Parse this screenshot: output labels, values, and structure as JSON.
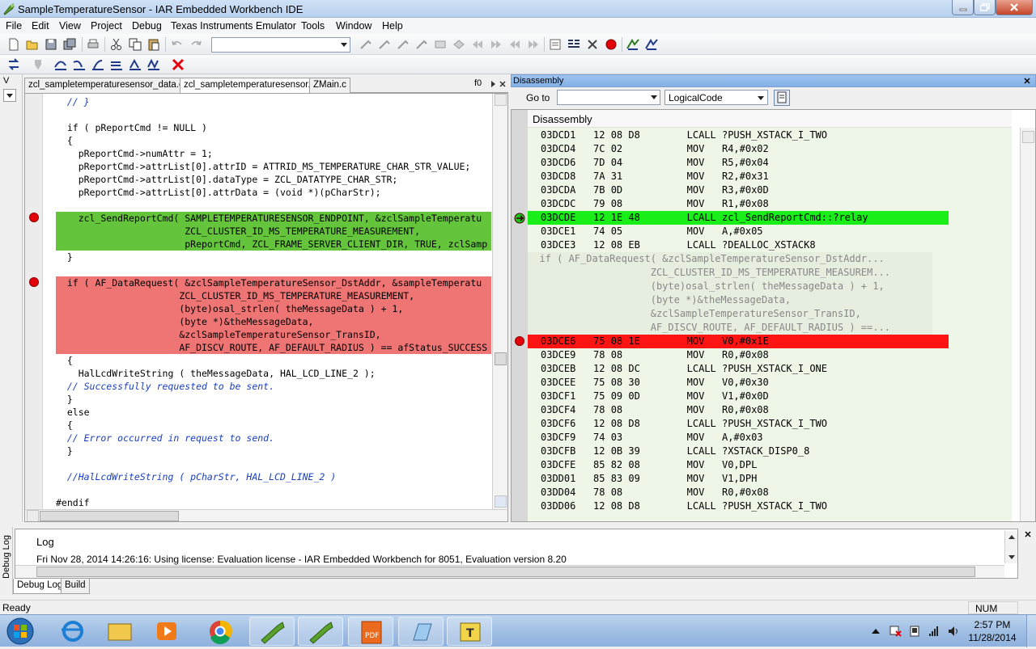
{
  "window": {
    "title": "SampleTemperatureSensor - IAR Embedded Workbench IDE"
  },
  "menu": [
    "File",
    "Edit",
    "View",
    "Project",
    "Debug",
    "Texas Instruments Emulator",
    "Tools",
    "Window",
    "Help"
  ],
  "editor": {
    "tabs": [
      {
        "label": "zcl_sampletemperaturesensor_data.c",
        "active": false
      },
      {
        "label": "zcl_sampletemperaturesensor.c",
        "active": true
      },
      {
        "label": "ZMain.c",
        "active": false
      }
    ],
    "func_combo": "f0",
    "lines": [
      {
        "text": "  // }",
        "style": "cmt"
      },
      {
        "text": "",
        "style": ""
      },
      {
        "text": "  if ( pReportCmd != NULL )",
        "style": ""
      },
      {
        "text": "  {",
        "style": ""
      },
      {
        "text": "    pReportCmd->numAttr = 1;",
        "style": ""
      },
      {
        "text": "    pReportCmd->attrList[0].attrID = ATTRID_MS_TEMPERATURE_CHAR_STR_VALUE;",
        "style": ""
      },
      {
        "text": "    pReportCmd->attrList[0].dataType = ZCL_DATATYPE_CHAR_STR;",
        "style": ""
      },
      {
        "text": "    pReportCmd->attrList[0].attrData = (void *)(pCharStr);",
        "style": ""
      },
      {
        "text": "",
        "style": ""
      },
      {
        "text": "    zcl_SendReportCmd( SAMPLETEMPERATURESENSOR_ENDPOINT, &zclSampleTemperatu",
        "style": "green"
      },
      {
        "text": "                       ZCL_CLUSTER_ID_MS_TEMPERATURE_MEASUREMENT,",
        "style": "green"
      },
      {
        "text": "                       pReportCmd, ZCL_FRAME_SERVER_CLIENT_DIR, TRUE, zclSamp",
        "style": "green"
      },
      {
        "text": "  }",
        "style": ""
      },
      {
        "text": "",
        "style": ""
      },
      {
        "text": "  if ( AF_DataRequest( &zclSampleTemperatureSensor_DstAddr, &sampleTemperatu",
        "style": "red"
      },
      {
        "text": "                      ZCL_CLUSTER_ID_MS_TEMPERATURE_MEASUREMENT,",
        "style": "red"
      },
      {
        "text": "                      (byte)osal_strlen( theMessageData ) + 1,",
        "style": "red"
      },
      {
        "text": "                      (byte *)&theMessageData,",
        "style": "red"
      },
      {
        "text": "                      &zclSampleTemperatureSensor_TransID,",
        "style": "red"
      },
      {
        "text": "                      AF_DISCV_ROUTE, AF_DEFAULT_RADIUS ) == afStatus_SUCCESS )",
        "style": "red"
      },
      {
        "text": "  {",
        "style": ""
      },
      {
        "text": "    HalLcdWriteString ( theMessageData, HAL_LCD_LINE_2 );",
        "style": ""
      },
      {
        "text": "  // Successfully requested to be sent.",
        "style": "cmt"
      },
      {
        "text": "  }",
        "style": ""
      },
      {
        "text": "  else",
        "style": ""
      },
      {
        "text": "  {",
        "style": ""
      },
      {
        "text": "  // Error occurred in request to send.",
        "style": "cmt"
      },
      {
        "text": "  }",
        "style": ""
      },
      {
        "text": "",
        "style": ""
      },
      {
        "text": "  //HalLcdWriteString ( pCharStr, HAL_LCD_LINE_2 )",
        "style": "cmt"
      },
      {
        "text": "",
        "style": ""
      },
      {
        "text": "#endif",
        "style": ""
      }
    ]
  },
  "disassembly": {
    "title": "Disassembly",
    "goto_label": "Go to",
    "goto_value": "",
    "mode": "LogicalCode",
    "header": "Disassembly",
    "rows": [
      {
        "text": "03DCD1   12 08 D8        LCALL ?PUSH_XSTACK_I_TWO",
        "kind": "asm"
      },
      {
        "text": "03DCD4   7C 02           MOV   R4,#0x02",
        "kind": "asm"
      },
      {
        "text": "03DCD6   7D 04           MOV   R5,#0x04",
        "kind": "asm"
      },
      {
        "text": "03DCD8   7A 31           MOV   R2,#0x31",
        "kind": "asm"
      },
      {
        "text": "03DCDA   7B 0D           MOV   R3,#0x0D",
        "kind": "asm"
      },
      {
        "text": "03DCDC   79 08           MOV   R1,#0x08",
        "kind": "asm"
      },
      {
        "text": "03DCDE   12 1E 48        LCALL zcl_SendReportCmd::?relay",
        "kind": "green"
      },
      {
        "text": "03DCE1   74 05           MOV   A,#0x05",
        "kind": "asm"
      },
      {
        "text": "03DCE3   12 08 EB        LCALL ?DEALLOC_XSTACK8",
        "kind": "asm"
      },
      {
        "text": "  if ( AF_DataRequest( &zclSampleTemperatureSensor_DstAddr...",
        "kind": "src"
      },
      {
        "text": "                     ZCL_CLUSTER_ID_MS_TEMPERATURE_MEASUREM...",
        "kind": "src"
      },
      {
        "text": "                     (byte)osal_strlen( theMessageData ) + 1,",
        "kind": "src"
      },
      {
        "text": "                     (byte *)&theMessageData,",
        "kind": "src"
      },
      {
        "text": "                     &zclSampleTemperatureSensor_TransID,",
        "kind": "src"
      },
      {
        "text": "                     AF_DISCV_ROUTE, AF_DEFAULT_RADIUS ) ==...",
        "kind": "src"
      },
      {
        "text": "03DCE6   75 08 1E        MOV   V0,#0x1E",
        "kind": "red"
      },
      {
        "text": "03DCE9   78 08           MOV   R0,#0x08",
        "kind": "asm"
      },
      {
        "text": "03DCEB   12 08 DC        LCALL ?PUSH_XSTACK_I_ONE",
        "kind": "asm"
      },
      {
        "text": "03DCEE   75 08 30        MOV   V0,#0x30",
        "kind": "asm"
      },
      {
        "text": "03DCF1   75 09 0D        MOV   V1,#0x0D",
        "kind": "asm"
      },
      {
        "text": "03DCF4   78 08           MOV   R0,#0x08",
        "kind": "asm"
      },
      {
        "text": "03DCF6   12 08 D8        LCALL ?PUSH_XSTACK_I_TWO",
        "kind": "asm"
      },
      {
        "text": "03DCF9   74 03           MOV   A,#0x03",
        "kind": "asm"
      },
      {
        "text": "03DCFB   12 0B 39        LCALL ?XSTACK_DISP0_8",
        "kind": "asm"
      },
      {
        "text": "03DCFE   85 82 08        MOV   V0,DPL",
        "kind": "asm"
      },
      {
        "text": "03DD01   85 83 09        MOV   V1,DPH",
        "kind": "asm"
      },
      {
        "text": "03DD04   78 08           MOV   R0,#0x08",
        "kind": "asm"
      },
      {
        "text": "03DD06   12 08 D8        LCALL ?PUSH_XSTACK_I_TWO",
        "kind": "asm"
      }
    ]
  },
  "log": {
    "side_label": "Debug Log",
    "header": "Log",
    "entry": "Fri Nov 28, 2014 14:26:16: Using license: Evaluation license - IAR Embedded Workbench for 8051, Evaluation version 8.20",
    "tabs": [
      "Debug Log",
      "Build"
    ]
  },
  "status": {
    "text": "Ready",
    "num": "NUM"
  },
  "taskbar": {
    "time": "2:57 PM",
    "date": "11/28/2014"
  }
}
